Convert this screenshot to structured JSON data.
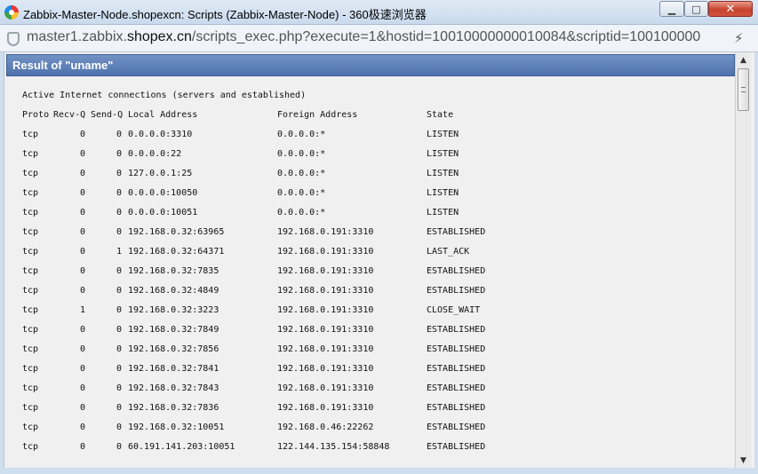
{
  "window": {
    "title": "Zabbix-Master-Node.shopexcn: Scripts (Zabbix-Master-Node) - 360极速浏览器",
    "minimize_label": "▁",
    "maximize_label": "□",
    "close_label": "✕"
  },
  "address": {
    "url_pre": "master1.zabbix.",
    "url_host": "shopex.cn",
    "url_post": "/scripts_exec.php?execute=1&hostid=10010000000010084&scriptid=100100000"
  },
  "result": {
    "title": "Result of \"uname\"",
    "intro": "Active Internet connections (servers and established)",
    "headers": {
      "proto": "Proto",
      "recv": "Recv-Q",
      "send": "Send-Q",
      "local": "Local Address",
      "foreign": "Foreign Address",
      "state": "State"
    },
    "rows": [
      {
        "proto": "tcp",
        "recv": "0",
        "send": "0",
        "local": "0.0.0.0:3310",
        "foreign": "0.0.0.0:*",
        "state": "LISTEN"
      },
      {
        "proto": "tcp",
        "recv": "0",
        "send": "0",
        "local": "0.0.0.0:22",
        "foreign": "0.0.0.0:*",
        "state": "LISTEN"
      },
      {
        "proto": "tcp",
        "recv": "0",
        "send": "0",
        "local": "127.0.0.1:25",
        "foreign": "0.0.0.0:*",
        "state": "LISTEN"
      },
      {
        "proto": "tcp",
        "recv": "0",
        "send": "0",
        "local": "0.0.0.0:10050",
        "foreign": "0.0.0.0:*",
        "state": "LISTEN"
      },
      {
        "proto": "tcp",
        "recv": "0",
        "send": "0",
        "local": "0.0.0.0:10051",
        "foreign": "0.0.0.0:*",
        "state": "LISTEN"
      },
      {
        "proto": "tcp",
        "recv": "0",
        "send": "0",
        "local": "192.168.0.32:63965",
        "foreign": "192.168.0.191:3310",
        "state": "ESTABLISHED"
      },
      {
        "proto": "tcp",
        "recv": "0",
        "send": "1",
        "local": "192.168.0.32:64371",
        "foreign": "192.168.0.191:3310",
        "state": "LAST_ACK"
      },
      {
        "proto": "tcp",
        "recv": "0",
        "send": "0",
        "local": "192.168.0.32:7835",
        "foreign": "192.168.0.191:3310",
        "state": "ESTABLISHED"
      },
      {
        "proto": "tcp",
        "recv": "0",
        "send": "0",
        "local": "192.168.0.32:4849",
        "foreign": "192.168.0.191:3310",
        "state": "ESTABLISHED"
      },
      {
        "proto": "tcp",
        "recv": "1",
        "send": "0",
        "local": "192.168.0.32:3223",
        "foreign": "192.168.0.191:3310",
        "state": "CLOSE_WAIT"
      },
      {
        "proto": "tcp",
        "recv": "0",
        "send": "0",
        "local": "192.168.0.32:7849",
        "foreign": "192.168.0.191:3310",
        "state": "ESTABLISHED"
      },
      {
        "proto": "tcp",
        "recv": "0",
        "send": "0",
        "local": "192.168.0.32:7856",
        "foreign": "192.168.0.191:3310",
        "state": "ESTABLISHED"
      },
      {
        "proto": "tcp",
        "recv": "0",
        "send": "0",
        "local": "192.168.0.32:7841",
        "foreign": "192.168.0.191:3310",
        "state": "ESTABLISHED"
      },
      {
        "proto": "tcp",
        "recv": "0",
        "send": "0",
        "local": "192.168.0.32:7843",
        "foreign": "192.168.0.191:3310",
        "state": "ESTABLISHED"
      },
      {
        "proto": "tcp",
        "recv": "0",
        "send": "0",
        "local": "192.168.0.32:7836",
        "foreign": "192.168.0.191:3310",
        "state": "ESTABLISHED"
      },
      {
        "proto": "tcp",
        "recv": "0",
        "send": "0",
        "local": "192.168.0.32:10051",
        "foreign": "192.168.0.46:22262",
        "state": "ESTABLISHED"
      },
      {
        "proto": "tcp",
        "recv": "0",
        "send": "0",
        "local": "60.191.141.203:10051",
        "foreign": "122.144.135.154:58848",
        "state": "ESTABLISHED"
      }
    ]
  },
  "icons": {
    "app": "360-browser-icon",
    "address": "shield-icon",
    "bolt": "lightning-icon",
    "scroll_up": "▲",
    "scroll_down": "▼"
  },
  "colors": {
    "header_bg": "#5577b3",
    "content_bg": "#f0f0f0"
  }
}
